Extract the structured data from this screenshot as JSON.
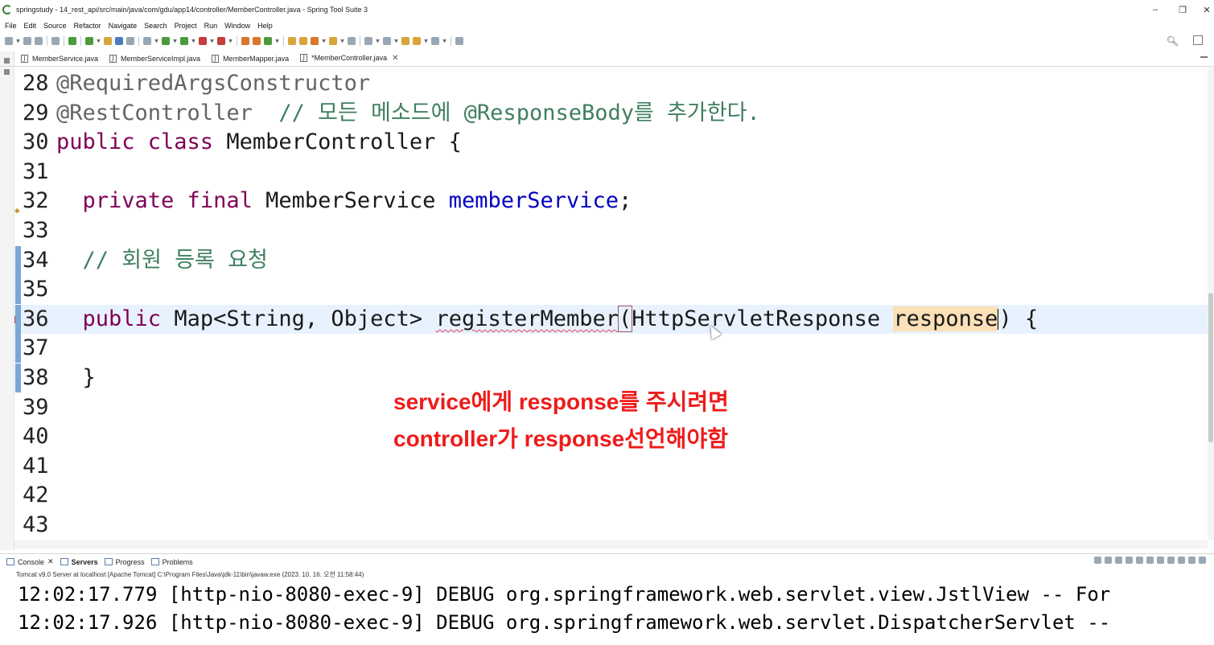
{
  "window": {
    "title": "springstudy - 14_rest_api/src/main/java/com/gdu/app14/controller/MemberController.java - Spring Tool Suite 3",
    "minimize": "–",
    "restore": "❐",
    "close": "✕"
  },
  "menu": [
    "File",
    "Edit",
    "Source",
    "Refactor",
    "Navigate",
    "Search",
    "Project",
    "Run",
    "Window",
    "Help"
  ],
  "editor_tabs": [
    {
      "label": "MemberService.java",
      "active": false
    },
    {
      "label": "MemberServiceImpl.java",
      "active": false
    },
    {
      "label": "MemberMapper.java",
      "active": false
    },
    {
      "label": "*MemberController.java",
      "active": true,
      "close": "✕"
    }
  ],
  "code_lines": [
    {
      "num": "28",
      "parts": [
        {
          "t": "@RequiredArgsConstructor",
          "c": "ann"
        }
      ]
    },
    {
      "num": "29",
      "parts": [
        {
          "t": "@RestController",
          "c": "ann"
        },
        {
          "t": "  // 모든 메소드에 @ResponseBody를 추가한다.",
          "c": "cmt"
        }
      ]
    },
    {
      "num": "30",
      "parts": [
        {
          "t": "public class",
          "c": "kw"
        },
        {
          "t": " MemberController {",
          "c": ""
        }
      ]
    },
    {
      "num": "31",
      "parts": []
    },
    {
      "num": "32",
      "parts": [
        {
          "t": "  ",
          "c": ""
        },
        {
          "t": "private final",
          "c": "kw"
        },
        {
          "t": " MemberService ",
          "c": ""
        },
        {
          "t": "memberService",
          "c": "fld"
        },
        {
          "t": ";",
          "c": ""
        }
      ]
    },
    {
      "num": "33",
      "parts": []
    },
    {
      "num": "34",
      "parts": [
        {
          "t": "  // 회원 등록 요청",
          "c": "cmt"
        }
      ]
    },
    {
      "num": "35",
      "parts": []
    },
    {
      "num": "36",
      "parts": [
        {
          "t": "  ",
          "c": ""
        },
        {
          "t": "public",
          "c": "kw"
        },
        {
          "t": " Map<String, Object> ",
          "c": ""
        },
        {
          "t": "registerMember",
          "c": "err"
        },
        {
          "t": "(",
          "c": "bracket"
        },
        {
          "t": "HttpServletResponse ",
          "c": ""
        },
        {
          "t": "response",
          "c": "hl"
        },
        {
          "t": ") {",
          "c": ""
        }
      ]
    },
    {
      "num": "37",
      "parts": []
    },
    {
      "num": "38",
      "parts": [
        {
          "t": "  }",
          "c": ""
        }
      ]
    },
    {
      "num": "39",
      "parts": []
    },
    {
      "num": "40",
      "parts": []
    },
    {
      "num": "41",
      "parts": []
    },
    {
      "num": "42",
      "parts": []
    },
    {
      "num": "43",
      "parts": []
    }
  ],
  "overlay": {
    "line1": "service에게 response를 주시려면",
    "line2": "controller가 response선언해야함",
    "color": "#ee1b1b"
  },
  "bottom_panel": {
    "tabs": [
      {
        "label": "Console",
        "close": "✕",
        "bold": false
      },
      {
        "label": "Servers",
        "bold": true
      },
      {
        "label": "Progress",
        "bold": false
      },
      {
        "label": "Problems",
        "bold": false
      }
    ],
    "console_header": "Tomcat v9.0 Server at localhost [Apache Tomcat] C:\\Program Files\\Java\\jdk-11\\bin\\javaw.exe  (2023. 10. 16. 오전 11:58:44)",
    "console_lines": [
      "12:02:17.779 [http-nio-8080-exec-9] DEBUG org.springframework.web.servlet.view.JstlView -- For",
      "12:02:17.926 [http-nio-8080-exec-9] DEBUG org.springframework.web.servlet.DispatcherServlet --"
    ]
  },
  "icons": {
    "search": "search-icon",
    "perspective": "open-perspective-icon"
  }
}
